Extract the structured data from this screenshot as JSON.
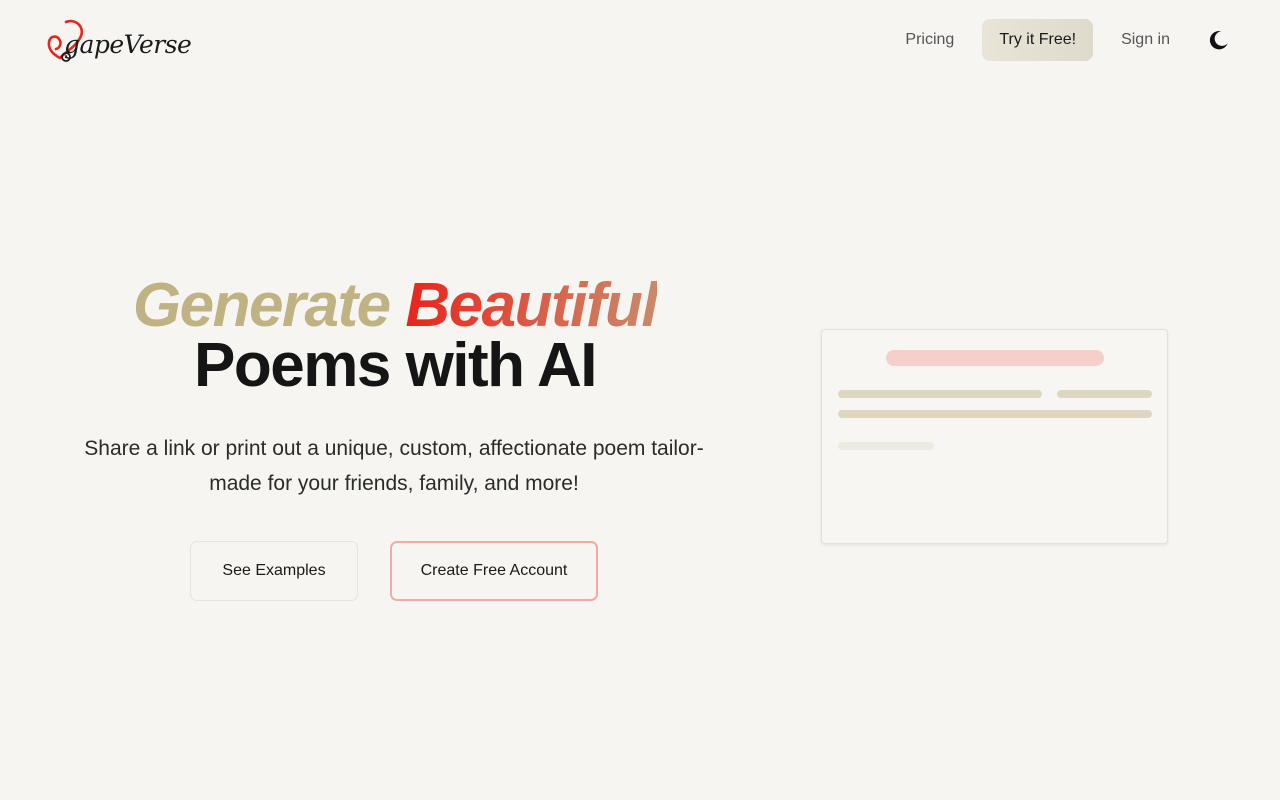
{
  "brand": {
    "name": "AgapeVerse",
    "display_text": "gapeVerse",
    "accent_color": "#e8241c"
  },
  "nav": {
    "pricing": "Pricing",
    "try_free": "Try it Free!",
    "sign_in": "Sign in",
    "theme_icon": "moon-icon"
  },
  "hero": {
    "title_word_1": "Generate",
    "title_word_2": "Beautiful",
    "title_rest": "Poems with AI",
    "subtitle": "Share a link or print out a unique, custom, affectionate poem tailor-made for your friends, family, and more!",
    "btn_examples": "See Examples",
    "btn_account": "Create Free Account"
  },
  "colors": {
    "background": "#f6f5f2",
    "generate_word": "#bfb283",
    "beautiful_gradient_start": "#e8241c",
    "beautiful_gradient_end": "#c98a6a",
    "cta_border": "#f0aca4"
  }
}
